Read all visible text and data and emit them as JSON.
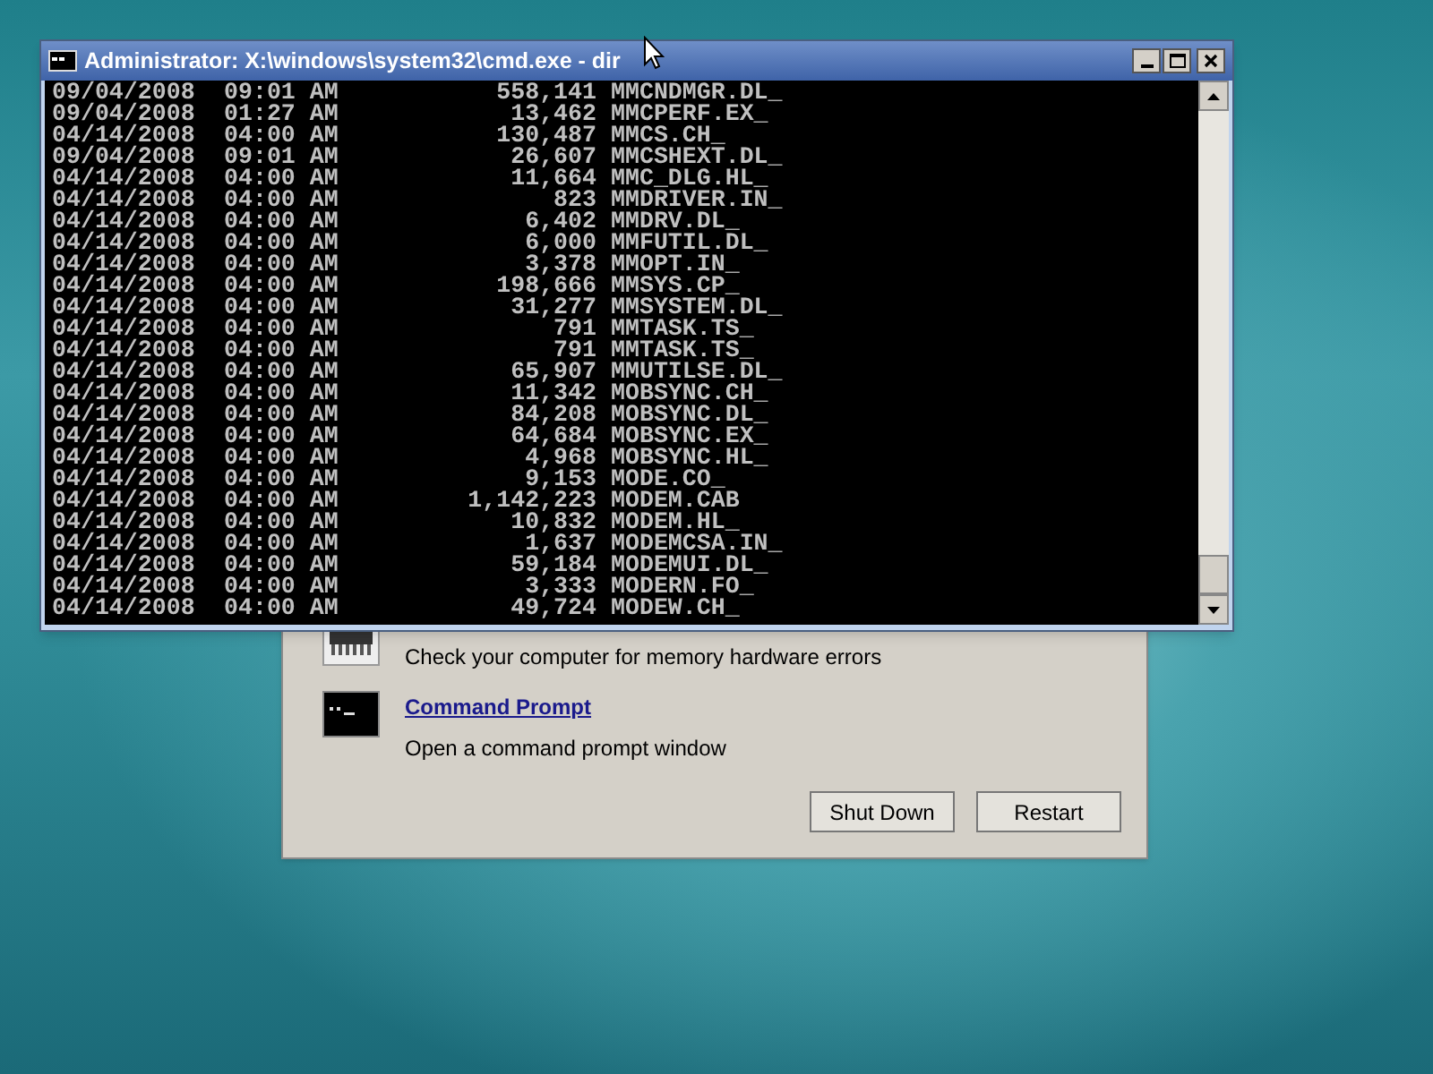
{
  "console_window": {
    "title": "Administrator: X:\\windows\\system32\\cmd.exe - dir",
    "lines": [
      {
        "date": "09/04/2008",
        "time": "09:01 AM",
        "size": "558,141",
        "name": "MMCNDMGR.DL_"
      },
      {
        "date": "09/04/2008",
        "time": "01:27 AM",
        "size": "13,462",
        "name": "MMCPERF.EX_"
      },
      {
        "date": "04/14/2008",
        "time": "04:00 AM",
        "size": "130,487",
        "name": "MMCS.CH_"
      },
      {
        "date": "09/04/2008",
        "time": "09:01 AM",
        "size": "26,607",
        "name": "MMCSHEXT.DL_"
      },
      {
        "date": "04/14/2008",
        "time": "04:00 AM",
        "size": "11,664",
        "name": "MMC_DLG.HL_"
      },
      {
        "date": "04/14/2008",
        "time": "04:00 AM",
        "size": "823",
        "name": "MMDRIVER.IN_"
      },
      {
        "date": "04/14/2008",
        "time": "04:00 AM",
        "size": "6,402",
        "name": "MMDRV.DL_"
      },
      {
        "date": "04/14/2008",
        "time": "04:00 AM",
        "size": "6,000",
        "name": "MMFUTIL.DL_"
      },
      {
        "date": "04/14/2008",
        "time": "04:00 AM",
        "size": "3,378",
        "name": "MMOPT.IN_"
      },
      {
        "date": "04/14/2008",
        "time": "04:00 AM",
        "size": "198,666",
        "name": "MMSYS.CP_"
      },
      {
        "date": "04/14/2008",
        "time": "04:00 AM",
        "size": "31,277",
        "name": "MMSYSTEM.DL_"
      },
      {
        "date": "04/14/2008",
        "time": "04:00 AM",
        "size": "791",
        "name": "MMTASK.TS_"
      },
      {
        "date": "04/14/2008",
        "time": "04:00 AM",
        "size": "791",
        "name": "MMTASK.TS_"
      },
      {
        "date": "04/14/2008",
        "time": "04:00 AM",
        "size": "65,907",
        "name": "MMUTILSE.DL_"
      },
      {
        "date": "04/14/2008",
        "time": "04:00 AM",
        "size": "11,342",
        "name": "MOBSYNC.CH_"
      },
      {
        "date": "04/14/2008",
        "time": "04:00 AM",
        "size": "84,208",
        "name": "MOBSYNC.DL_"
      },
      {
        "date": "04/14/2008",
        "time": "04:00 AM",
        "size": "64,684",
        "name": "MOBSYNC.EX_"
      },
      {
        "date": "04/14/2008",
        "time": "04:00 AM",
        "size": "4,968",
        "name": "MOBSYNC.HL_"
      },
      {
        "date": "04/14/2008",
        "time": "04:00 AM",
        "size": "9,153",
        "name": "MODE.CO_"
      },
      {
        "date": "04/14/2008",
        "time": "04:00 AM",
        "size": "1,142,223",
        "name": "MODEM.CAB"
      },
      {
        "date": "04/14/2008",
        "time": "04:00 AM",
        "size": "10,832",
        "name": "MODEM.HL_"
      },
      {
        "date": "04/14/2008",
        "time": "04:00 AM",
        "size": "1,637",
        "name": "MODEMCSA.IN_"
      },
      {
        "date": "04/14/2008",
        "time": "04:00 AM",
        "size": "59,184",
        "name": "MODEMUI.DL_"
      },
      {
        "date": "04/14/2008",
        "time": "04:00 AM",
        "size": "3,333",
        "name": "MODERN.FO_"
      },
      {
        "date": "04/14/2008",
        "time": "04:00 AM",
        "size": "49,724",
        "name": "MODEW.CH_"
      }
    ]
  },
  "recovery_dialog": {
    "tools": [
      {
        "kind": "memory",
        "description": "Check your computer for memory hardware errors"
      },
      {
        "kind": "prompt",
        "title": "Command Prompt",
        "description": "Open a command prompt window"
      }
    ],
    "buttons": [
      "Shut Down",
      "Restart"
    ]
  }
}
